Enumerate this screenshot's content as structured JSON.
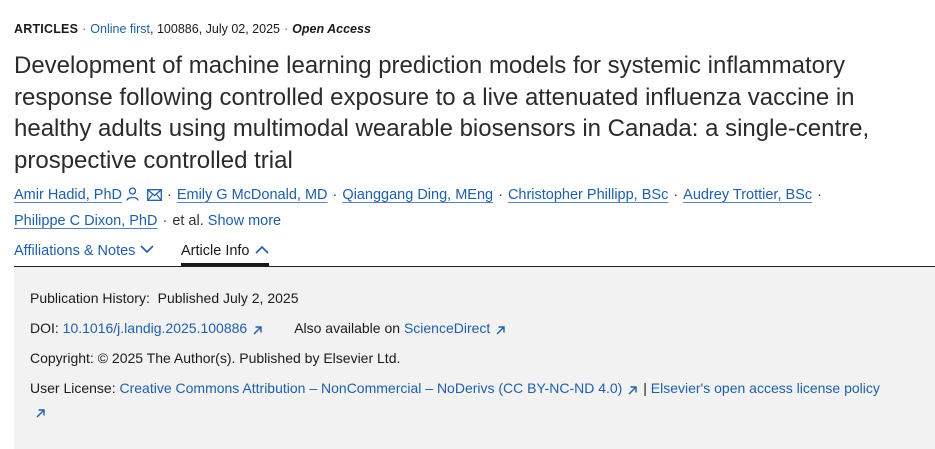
{
  "meta": {
    "type": "ARTICLES",
    "online_first": "Online first",
    "details": ", 100886, July 02, 2025",
    "access": "Open Access"
  },
  "title": "Development of machine learning prediction models for systemic inflammatory response following controlled exposure to a live attenuated influenza vaccine in healthy adults using multimodal wearable biosensors in Canada: a single-centre, prospective controlled trial",
  "authors": [
    "Amir Hadid, PhD",
    "Emily G McDonald, MD",
    "Qianggang Ding, MEng",
    "Christopher Phillipp, BSc",
    "Audrey Trottier, BSc",
    "Philippe C Dixon, PhD"
  ],
  "et_al": "et al.",
  "show_more": "Show more",
  "tabs": {
    "affiliations": "Affiliations & Notes",
    "article_info": "Article Info"
  },
  "info": {
    "history_label": "Publication History:",
    "history_value": "Published July 2, 2025",
    "doi_label": "DOI:",
    "doi_value": "10.1016/j.landig.2025.100886",
    "also_available": "Also available on",
    "sciencedirect": "ScienceDirect",
    "copyright": "Copyright: © 2025 The Author(s). Published by Elsevier Ltd.",
    "license_label": "User License:",
    "license_link": "Creative Commons Attribution – NonCommercial – NoDerivs (CC BY-NC-ND 4.0)",
    "license_sep": "|",
    "elsevier_policy": "Elsevier's open access license policy"
  },
  "icons": {
    "person": "person-icon",
    "mail": "mail-icon",
    "chevron_down": "chevron-down-icon",
    "chevron_up": "chevron-up-icon",
    "external": "external-link-icon"
  },
  "colors": {
    "link": "#1e5fa8",
    "panel_bg": "#f2f2f2"
  }
}
